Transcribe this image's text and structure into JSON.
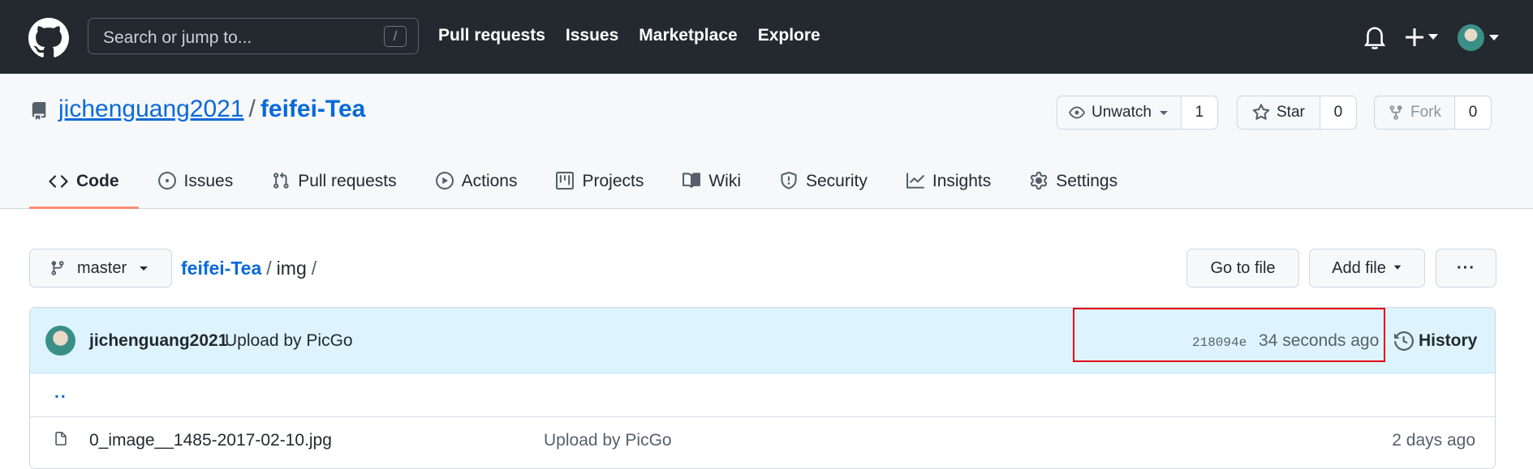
{
  "topbar": {
    "search_placeholder": "Search or jump to...",
    "search_shortcut": "/",
    "nav": [
      "Pull requests",
      "Issues",
      "Marketplace",
      "Explore"
    ]
  },
  "repo": {
    "owner": "jichenguang2021",
    "separator": "/",
    "name": "feifei-Tea",
    "watch": {
      "label": "Unwatch",
      "count": "1"
    },
    "star": {
      "label": "Star",
      "count": "0"
    },
    "fork": {
      "label": "Fork",
      "count": "0"
    }
  },
  "tabs": [
    {
      "label": "Code",
      "icon": "code-icon",
      "active": true
    },
    {
      "label": "Issues",
      "icon": "issue-icon"
    },
    {
      "label": "Pull requests",
      "icon": "pull-request-icon"
    },
    {
      "label": "Actions",
      "icon": "play-icon"
    },
    {
      "label": "Projects",
      "icon": "project-icon"
    },
    {
      "label": "Wiki",
      "icon": "book-icon"
    },
    {
      "label": "Security",
      "icon": "shield-icon"
    },
    {
      "label": "Insights",
      "icon": "graph-icon"
    },
    {
      "label": "Settings",
      "icon": "gear-icon"
    }
  ],
  "filenav": {
    "branch": "master",
    "crumb_root": "feifei-Tea",
    "crumb_sep": "/",
    "crumb_current": "img",
    "crumb_trailing": "/",
    "goto_file": "Go to file",
    "add_file": "Add file",
    "more": "···"
  },
  "commit": {
    "author": "jichenguang2021",
    "message": "Upload by PicGo",
    "sha": "218094e",
    "time": "34 seconds ago",
    "history": "History"
  },
  "files": {
    "parent": "..",
    "rows": [
      {
        "name": "0_image__1485-2017-02-10.jpg",
        "message": "Upload by PicGo",
        "age": "2 days ago"
      }
    ]
  },
  "colors": {
    "header_bg": "#24292f",
    "link": "#0969da",
    "active_tab_underline": "#fd8c73",
    "commit_bar_bg": "#ddf4ff",
    "highlight": "#e3000f"
  }
}
